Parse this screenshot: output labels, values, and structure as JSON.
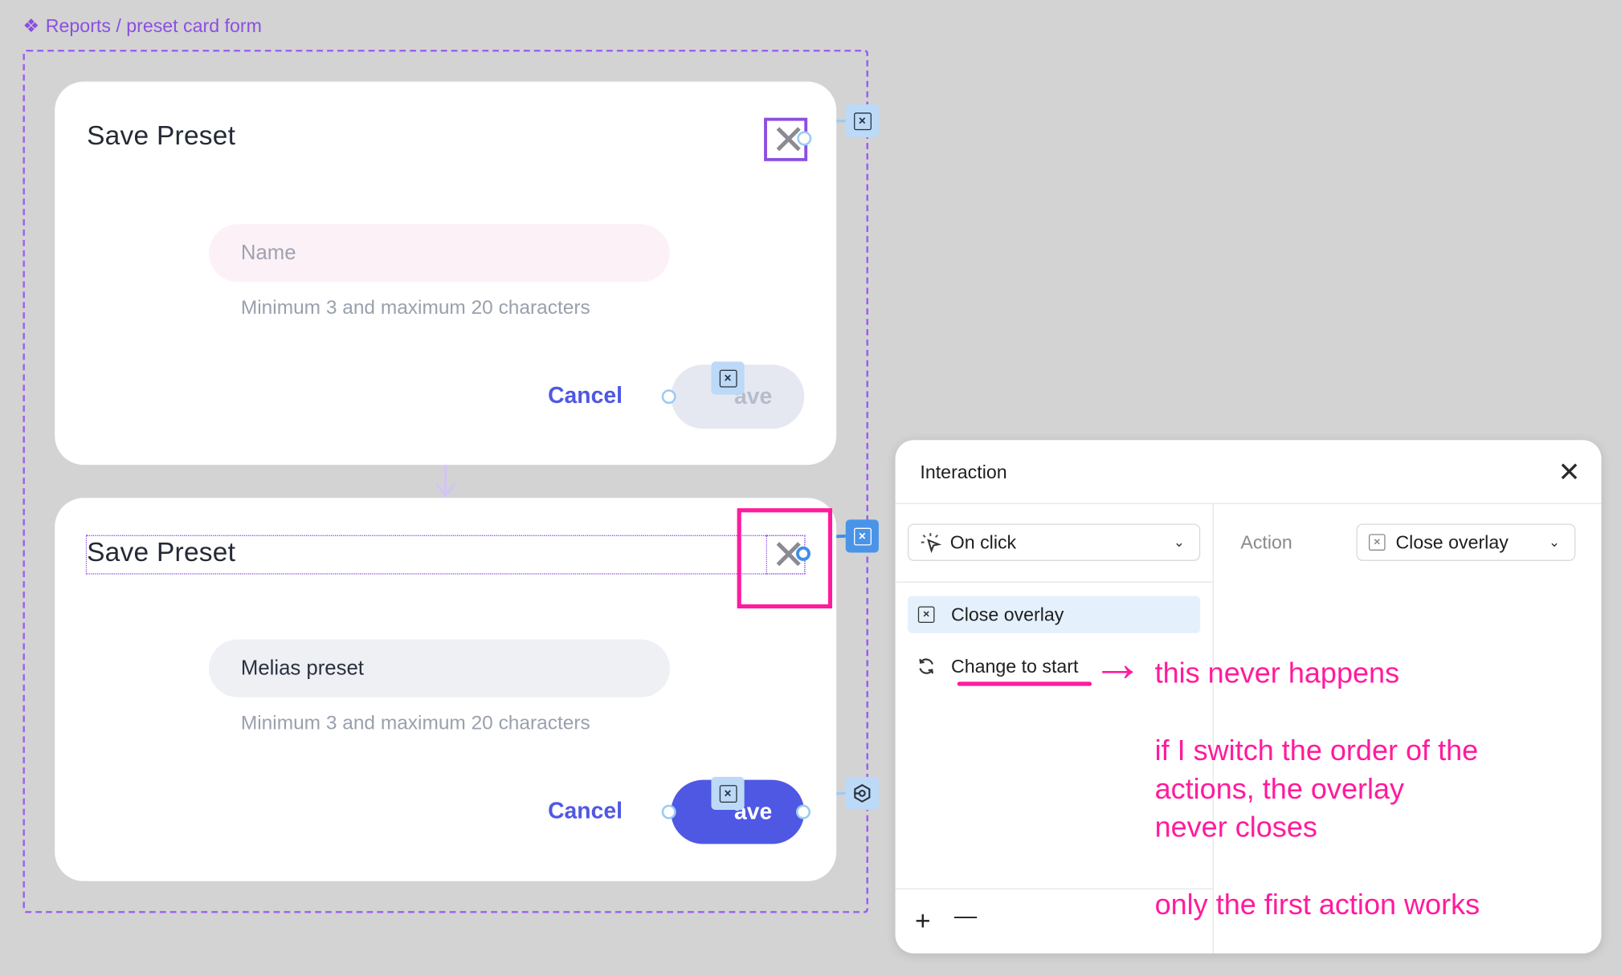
{
  "breadcrumb": {
    "icon": "component-set-icon",
    "text": "Reports / preset card form"
  },
  "variant_default": {
    "title": "Save Preset",
    "name_placeholder": "Name",
    "hint": "Minimum 3 and maximum 20 characters",
    "cancel_label": "Cancel",
    "save_label": "Save",
    "save_visible_fragment": "ave"
  },
  "variant_filled": {
    "title": "Save Preset",
    "name_value": "Melias preset",
    "hint": "Minimum 3 and maximum 20 characters",
    "cancel_label": "Cancel",
    "save_label": "Save",
    "save_visible_fragment": "ave"
  },
  "interaction_panel": {
    "title": "Interaction",
    "trigger": "On click",
    "action_label": "Action",
    "action_value": "Close overlay",
    "actions": [
      {
        "label": "Close overlay",
        "icon": "close-overlay-icon",
        "selected": true
      },
      {
        "label": "Change to start",
        "icon": "refresh-icon",
        "selected": false
      }
    ],
    "add_symbol": "+",
    "remove_symbol": "—"
  },
  "annotations": {
    "note_1": "this never happens",
    "note_2_lines": [
      "if I switch the order of the",
      "actions, the overlay",
      "never closes"
    ],
    "note_3": "only the first action works"
  },
  "colors": {
    "canvas": "#d3d3d3",
    "component_purple": "#8b4fe0",
    "brand_blue": "#4f58e3",
    "annotation_pink": "#ff1b9c",
    "proto_blue": "#4a94e8"
  }
}
